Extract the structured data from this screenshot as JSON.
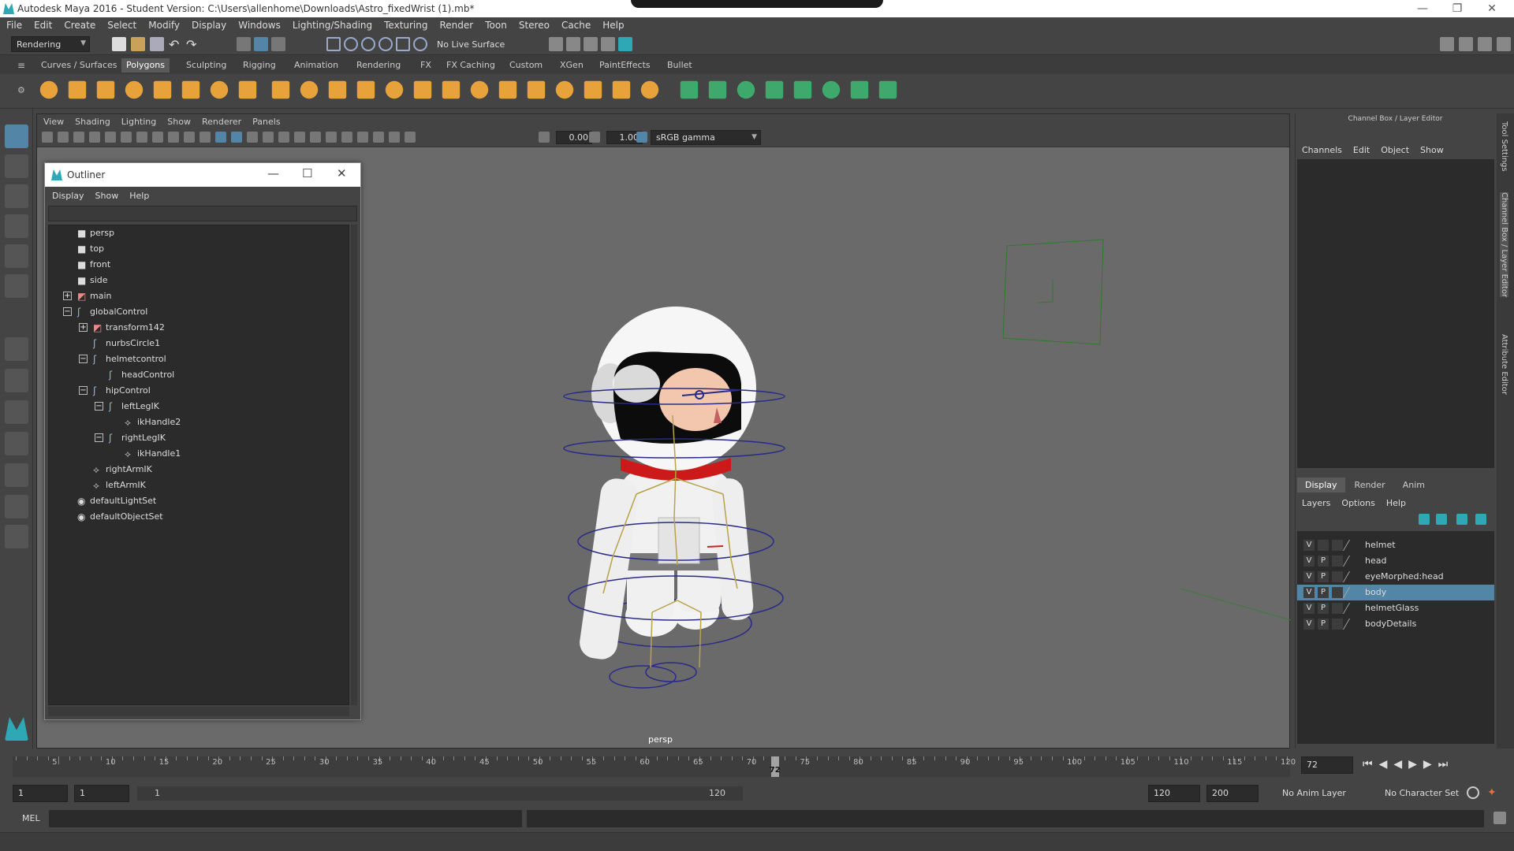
{
  "window": {
    "title": "Autodesk Maya 2016 - Student Version: C:\\Users\\allenhome\\Downloads\\Astro_fixedWrist (1).mb*"
  },
  "menubar": [
    "File",
    "Edit",
    "Create",
    "Select",
    "Modify",
    "Display",
    "Windows",
    "Lighting/Shading",
    "Texturing",
    "Render",
    "Toon",
    "Stereo",
    "Cache",
    "Help"
  ],
  "status": {
    "menuset": "Rendering",
    "live_surface": "No Live Surface"
  },
  "shelf_tabs": [
    "Curves / Surfaces",
    "Polygons",
    "Sculpting",
    "Rigging",
    "Animation",
    "Rendering",
    "FX",
    "FX Caching",
    "Custom",
    "XGen",
    "PaintEffects",
    "Bullet"
  ],
  "viewport": {
    "menu": [
      "View",
      "Shading",
      "Lighting",
      "Show",
      "Renderer",
      "Panels"
    ],
    "exposure": "0.00",
    "gamma": "1.00",
    "colorspace": "sRGB gamma",
    "camera_label": "persp"
  },
  "outliner": {
    "title": "Outliner",
    "menu": [
      "Display",
      "Show",
      "Help"
    ],
    "rows": [
      {
        "label": "persp",
        "icon": "camera"
      },
      {
        "label": "top",
        "icon": "camera"
      },
      {
        "label": "front",
        "icon": "camera"
      },
      {
        "label": "side",
        "icon": "camera"
      },
      {
        "label": "main",
        "icon": "mesh",
        "exp": "+"
      },
      {
        "label": "globalControl",
        "icon": "curve",
        "exp": "-"
      },
      {
        "label": "transform142",
        "icon": "mesh",
        "exp": "+"
      },
      {
        "label": "nurbsCircle1",
        "icon": "curve"
      },
      {
        "label": "helmetcontrol",
        "icon": "curve",
        "exp": "-"
      },
      {
        "label": "headControl",
        "icon": "curve"
      },
      {
        "label": "hipControl",
        "icon": "curve",
        "exp": "-"
      },
      {
        "label": "leftLegIK",
        "icon": "curve",
        "exp": "-"
      },
      {
        "label": "ikHandle2",
        "icon": "ik"
      },
      {
        "label": "rightLegIK",
        "icon": "curve",
        "exp": "-"
      },
      {
        "label": "ikHandle1",
        "icon": "ik"
      },
      {
        "label": "rightArmIK",
        "icon": "ik"
      },
      {
        "label": "leftArmIK",
        "icon": "ik"
      },
      {
        "label": "defaultLightSet",
        "icon": "set"
      },
      {
        "label": "defaultObjectSet",
        "icon": "set"
      }
    ]
  },
  "channel_box": {
    "title": "Channel Box / Layer Editor",
    "menu": [
      "Channels",
      "Edit",
      "Object",
      "Show"
    ]
  },
  "layer_editor": {
    "tabs": [
      "Display",
      "Render",
      "Anim"
    ],
    "menu": [
      "Layers",
      "Options",
      "Help"
    ],
    "layers": [
      {
        "v": "V",
        "p": "",
        "name": "helmet",
        "selected": false
      },
      {
        "v": "V",
        "p": "P",
        "name": "head",
        "selected": false
      },
      {
        "v": "V",
        "p": "P",
        "name": "eyeMorphed:head",
        "selected": false
      },
      {
        "v": "V",
        "p": "P",
        "name": "body",
        "selected": true
      },
      {
        "v": "V",
        "p": "P",
        "name": "helmetGlass",
        "selected": false
      },
      {
        "v": "V",
        "p": "P",
        "name": "bodyDetails",
        "selected": false
      }
    ]
  },
  "side_tabs": [
    "Tool Settings",
    "Channel Box / Layer Editor",
    "Attribute Editor"
  ],
  "timeline": {
    "ticks": [
      "5",
      "10",
      "15",
      "20",
      "25",
      "30",
      "35",
      "40",
      "45",
      "50",
      "55",
      "60",
      "65",
      "70",
      "75",
      "80",
      "85",
      "90",
      "95",
      "100",
      "105",
      "110",
      "115",
      "120"
    ],
    "current_frame": "72",
    "current_frame_field": "72"
  },
  "range": {
    "start": "1",
    "playback_start": "1",
    "slider_start": "1",
    "slider_end": "120",
    "playback_end": "120",
    "end": "200",
    "anim_layer": "No Anim Layer",
    "character_set": "No Character Set"
  },
  "command": {
    "language": "MEL"
  },
  "colors": {
    "accent": "#5285a6",
    "shelf_orange": "#e8a23c",
    "shelf_green": "#3ea86d",
    "viewport_bg": "#6a6a6a"
  }
}
